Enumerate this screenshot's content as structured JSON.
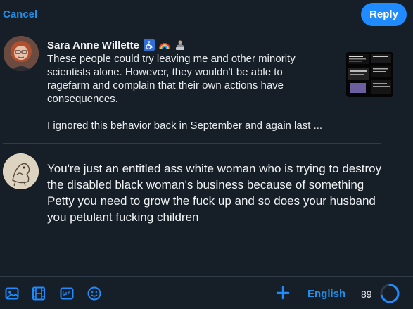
{
  "header": {
    "cancel_label": "Cancel",
    "reply_label": "Reply"
  },
  "quoted_post": {
    "author": "Sara Anne Willette",
    "badges": [
      "wheelchair-icon",
      "rainbow-icon",
      "technologist-icon"
    ],
    "text": "These people could try leaving me and other minority\nscientists alone. However, they wouldn't be able to\nragefarm and complain that their own actions have\nconsequences.\n\nI ignored this behavior back in September and again last ..."
  },
  "reply": {
    "text": "You're just an entitled ass white woman who is trying to destroy the disabled black woman's business because of something Petty you need to grow the fuck up and so does your husband you petulant fucking children"
  },
  "footer": {
    "language": "English",
    "chars_remaining": "89",
    "char_limit_progress": 0.7,
    "accent_color": "#208bfe"
  }
}
